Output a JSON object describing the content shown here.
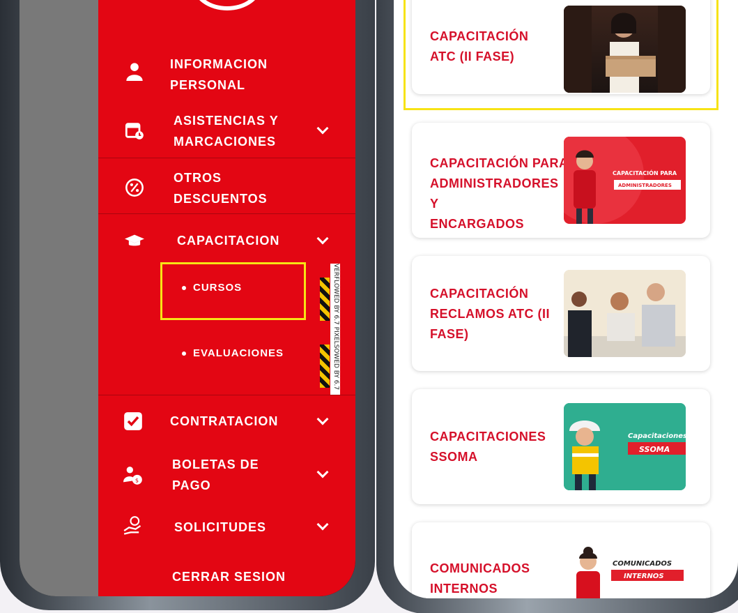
{
  "menu": {
    "items": [
      {
        "label": "INFORMACION\nPERSONAL",
        "icon": "person-icon",
        "expandable": false
      },
      {
        "label": "ASISTENCIAS Y\nMARCACIONES",
        "icon": "calendar-clock-icon",
        "expandable": true
      },
      {
        "label": "OTROS\nDESCUENTOS",
        "icon": "percent-icon",
        "expandable": false
      },
      {
        "label": "CAPACITACION",
        "icon": "graduation-cap-icon",
        "expandable": true
      },
      {
        "label": "CONTRATACION",
        "icon": "checkbox-icon",
        "expandable": true
      },
      {
        "label": "BOLETAS DE\nPAGO",
        "icon": "person-money-icon",
        "expandable": true
      },
      {
        "label": "SOLICITUDES",
        "icon": "hand-money-icon",
        "expandable": true
      },
      {
        "label": "CERRAR SESION",
        "icon": "",
        "expandable": false
      }
    ],
    "sub_items": [
      {
        "label": "CURSOS"
      },
      {
        "label": "EVALUACIONES"
      }
    ],
    "watermark_text": "VERFLOWED BY 6.7 PIXELSOWED BY 6.7"
  },
  "courses": [
    {
      "title": "CAPACITACIÓN\nATC (II FASE)",
      "image": "delivery-woman-photo"
    },
    {
      "title": "CAPACITACIÓN PARA\nADMINISTRADORES Y\nENCARGADOS",
      "image": "admin-banner",
      "banner_line1": "CAPACITACIÓN PARA",
      "banner_line2": "ADMINISTRADORES"
    },
    {
      "title": "CAPACITACIÓN\nRECLAMOS ATC (II\nFASE)",
      "image": "meeting-photo"
    },
    {
      "title": "CAPACITACIONES\nSSOMA",
      "image": "ssoma-banner",
      "banner_line1": "Capacitaciones",
      "banner_line2": "SSOMA"
    },
    {
      "title": "COMUNICADOS\nINTERNOS",
      "image": "comunicados-banner",
      "banner_line1": "COMUNICADOS",
      "banner_line2": "INTERNOS"
    }
  ],
  "colors": {
    "brand_red": "#e30613",
    "highlight": "#f7e315",
    "title_red": "#d5102a"
  }
}
